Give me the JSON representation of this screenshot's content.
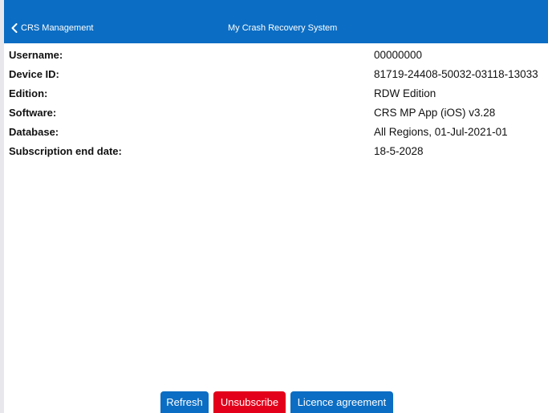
{
  "header": {
    "back_label": "CRS Management",
    "title": "My Crash Recovery System"
  },
  "info": [
    {
      "label": "Username:",
      "value": "00000000"
    },
    {
      "label": "Device ID:",
      "value": "81719-24408-50032-03118-13033"
    },
    {
      "label": "Edition:",
      "value": "RDW Edition"
    },
    {
      "label": "Software:",
      "value": "CRS MP App (iOS) v3.28"
    },
    {
      "label": "Database:",
      "value": "All Regions, 01-Jul-2021-01"
    },
    {
      "label": "Subscription end date:",
      "value": "18-5-2028"
    }
  ],
  "buttons": {
    "refresh": "Refresh",
    "unsubscribe": "Unsubscribe",
    "licence": "Licence agreement"
  },
  "colors": {
    "primary": "#0b6dc3",
    "danger": "#e2001a"
  },
  "icons": {
    "back": "chevron-left-icon"
  }
}
